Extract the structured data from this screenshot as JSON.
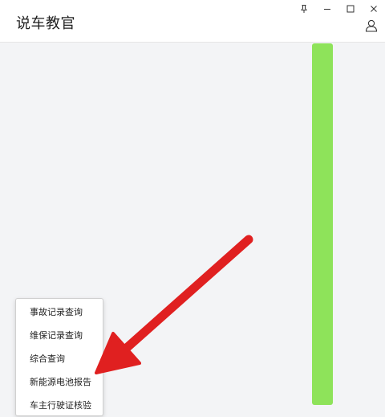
{
  "app": {
    "title": "说车教官"
  },
  "window_controls": {
    "icons": [
      "pin-icon",
      "minimize-icon",
      "maximize-icon",
      "close-icon"
    ]
  },
  "header": {
    "user_icon": "user-icon"
  },
  "context_menu": {
    "items": [
      {
        "label": "事故记录查询"
      },
      {
        "label": "维保记录查询"
      },
      {
        "label": "综合查询"
      },
      {
        "label": "新能源电池报告"
      },
      {
        "label": "车主行驶证核验"
      }
    ]
  },
  "colors": {
    "accent_bar": "#8ee35a",
    "arrow": "#e02020",
    "background": "#f3f4f6"
  }
}
